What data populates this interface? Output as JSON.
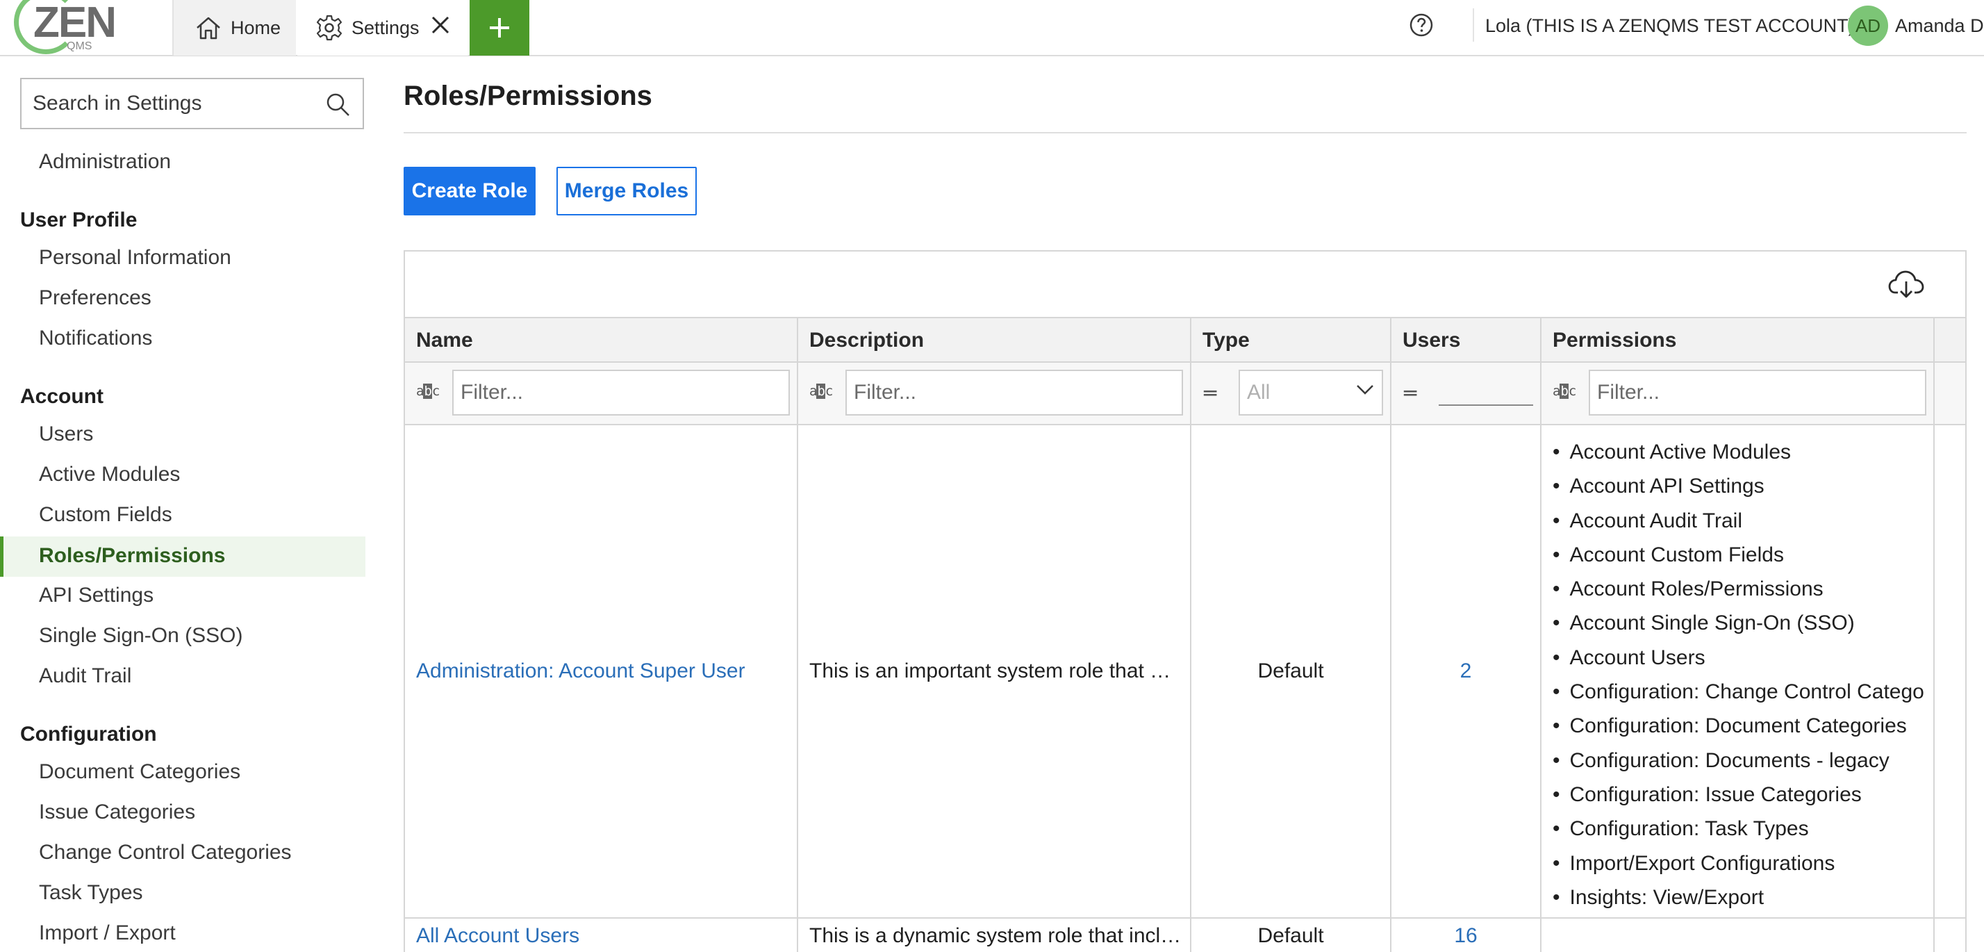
{
  "topbar": {
    "logo": {
      "text": "ZEN",
      "subtext": "QMS"
    },
    "tabs": [
      {
        "label": "Home",
        "icon": "home-icon"
      },
      {
        "label": "Settings",
        "icon": "gear-icon"
      }
    ],
    "add_tab_icon": "plus-icon",
    "help_icon": "help-icon",
    "account_name": "Lola (THIS IS A ZENQMS TEST ACCOUNT)",
    "user_initials": "AD",
    "user_name": "Amanda D"
  },
  "sidebar": {
    "search_placeholder": "Search in Settings",
    "top_link": "Administration",
    "sections": [
      {
        "heading": "User Profile",
        "items": [
          "Personal Information",
          "Preferences",
          "Notifications"
        ]
      },
      {
        "heading": "Account",
        "items": [
          "Users",
          "Active Modules",
          "Custom Fields",
          "Roles/Permissions",
          "API Settings",
          "Single Sign-On (SSO)",
          "Audit Trail"
        ]
      },
      {
        "heading": "Configuration",
        "items": [
          "Document Categories",
          "Issue Categories",
          "Change Control Categories",
          "Task Types",
          "Import / Export"
        ]
      }
    ],
    "active_item": "Roles/Permissions"
  },
  "main": {
    "title": "Roles/Permissions",
    "create_role_label": "Create Role",
    "merge_roles_label": "Merge Roles",
    "download_icon": "cloud-download-icon",
    "columns": [
      "Name",
      "Description",
      "Type",
      "Users",
      "Permissions"
    ],
    "filters": {
      "name_placeholder": "Filter...",
      "description_placeholder": "Filter...",
      "type_value": "All",
      "users_value": "",
      "permissions_placeholder": "Filter...",
      "text_filter_icon": "abc",
      "equals_filter_icon": "="
    },
    "rows": [
      {
        "name": "Administration: Account Super User",
        "description": "This is an important system role that …",
        "type": "Default",
        "users": "2",
        "permissions": [
          "Account Active Modules",
          "Account API Settings",
          "Account Audit Trail",
          "Account Custom Fields",
          "Account Roles/Permissions",
          "Account Single Sign-On (SSO)",
          "Account Users",
          "Configuration: Change Control Catego",
          "Configuration: Document Categories",
          "Configuration: Documents - legacy",
          "Configuration: Issue Categories",
          "Configuration: Task Types",
          "Import/Export Configurations",
          "Insights: View/Export"
        ]
      },
      {
        "name": "All Account Users",
        "description": "This is a dynamic system role that incl…",
        "type": "Default",
        "users": "16",
        "permissions": []
      }
    ]
  }
}
